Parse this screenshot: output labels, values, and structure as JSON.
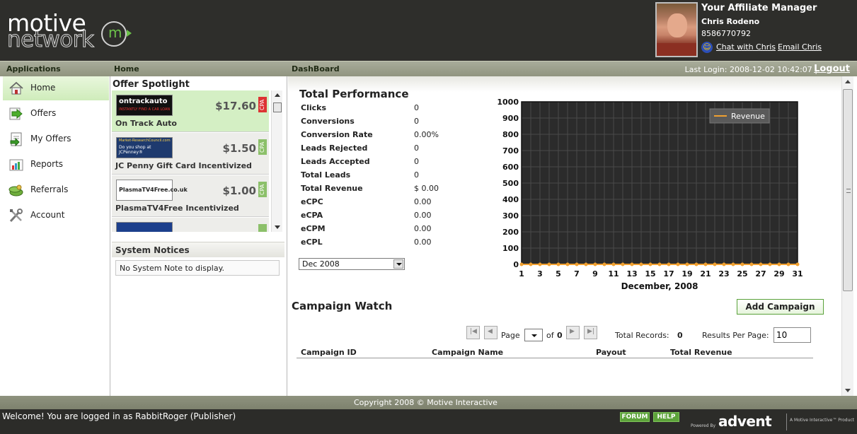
{
  "header": {
    "logo_line1": "motive",
    "logo_line2": "network",
    "logo_m": "m",
    "manager": {
      "title": "Your Affiliate Manager",
      "name": "Chris Rodeno",
      "phone": "8586770792",
      "chat_label": "Chat with Chris",
      "email_label": "Email Chris"
    }
  },
  "nav": {
    "applications": "Applications",
    "home": "Home",
    "dashboard": "DashBoard",
    "last_login": "Last Login: 2008-12-02 10:42:07 |",
    "logout": "Logout"
  },
  "sidebar": {
    "items": [
      {
        "label": "Home",
        "icon": "house-icon",
        "active": true
      },
      {
        "label": "Offers",
        "icon": "arrow-icon",
        "active": false
      },
      {
        "label": "My Offers",
        "icon": "document-icon",
        "active": false
      },
      {
        "label": "Reports",
        "icon": "report-icon",
        "active": false
      },
      {
        "label": "Referrals",
        "icon": "money-icon",
        "active": false
      },
      {
        "label": "Account",
        "icon": "tools-icon",
        "active": false
      }
    ]
  },
  "spotlight": {
    "title": "Offer Spotlight",
    "offers": [
      {
        "name": "On Track Auto",
        "price": "$17.60",
        "tag": "CPA",
        "logo_text": "ontrackauto",
        "logo_sub": "INSTANTLY FIND A CAR LOAN"
      },
      {
        "name": "JC Penny Gift Card Incentivized",
        "price": "$1.50",
        "tag": "CPA",
        "logo_text": "Do you shop at JCPenney®",
        "logo_sub": "Market-ResearchCouncil.com"
      },
      {
        "name": "PlasmaTV4Free Incentivized",
        "price": "$1.00",
        "tag": "CPA",
        "logo_text": "PlasmaTV4Free.co.uk",
        "logo_sub": ""
      }
    ]
  },
  "notices": {
    "title": "System Notices",
    "message": "No System Note to display."
  },
  "performance": {
    "title": "Total Performance",
    "stats": [
      {
        "label": "Clicks",
        "value": "0"
      },
      {
        "label": "Conversions",
        "value": "0"
      },
      {
        "label": "Conversion Rate",
        "value": "0.00%"
      },
      {
        "label": "Leads Rejected",
        "value": "0"
      },
      {
        "label": "Leads Accepted",
        "value": "0"
      },
      {
        "label": "Total Leads",
        "value": "0"
      },
      {
        "label": "Total Revenue",
        "value": "$ 0.00"
      },
      {
        "label": "eCPC",
        "value": "0.00"
      },
      {
        "label": "eCPA",
        "value": "0.00"
      },
      {
        "label": "eCPM",
        "value": "0.00"
      },
      {
        "label": "eCPL",
        "value": "0.00"
      }
    ],
    "month": "Dec 2008"
  },
  "colors": {
    "chart_bg": "#2b2b2b",
    "grid": "#4a4a4a",
    "line": "#f0a030",
    "green_accent": "#5da33b"
  },
  "chart_data": {
    "type": "line",
    "xlabel": "December, 2008",
    "ylabel": "",
    "ylim": [
      0,
      1000
    ],
    "yticks": [
      0,
      100,
      200,
      300,
      400,
      500,
      600,
      700,
      800,
      900,
      1000
    ],
    "xtick_labels": [
      "1",
      "3",
      "5",
      "7",
      "9",
      "11",
      "13",
      "15",
      "17",
      "19",
      "21",
      "23",
      "25",
      "27",
      "29",
      "31"
    ],
    "x": [
      1,
      2,
      3,
      4,
      5,
      6,
      7,
      8,
      9,
      10,
      11,
      12,
      13,
      14,
      15,
      16,
      17,
      18,
      19,
      20,
      21,
      22,
      23,
      24,
      25,
      26,
      27,
      28,
      29,
      30,
      31
    ],
    "series": [
      {
        "name": "Revenue",
        "values": [
          0,
          0,
          0,
          0,
          0,
          0,
          0,
          0,
          0,
          0,
          0,
          0,
          0,
          0,
          0,
          0,
          0,
          0,
          0,
          0,
          0,
          0,
          0,
          0,
          0,
          0,
          0,
          0,
          0,
          0,
          0
        ]
      }
    ],
    "legend": "top-right",
    "grid": true
  },
  "campaign": {
    "title": "Campaign Watch",
    "add_label": "Add Campaign",
    "page_label": "Page",
    "of_label": "of",
    "page_total": "0",
    "records_label": "Total Records:",
    "records_value": "0",
    "per_page_label": "Results Per Page:",
    "per_page_value": "10",
    "columns": [
      "Campaign ID",
      "Campaign Name",
      "Payout",
      "Total Revenue"
    ]
  },
  "footer": {
    "copyright": "Copyright 2008 © Motive Interactive",
    "welcome": "Welcome! You are logged in as RabbitRoger (Publisher)",
    "forum": "FORUM",
    "help": "HELP",
    "powered": "Powered By",
    "advent": "advent",
    "advent_sub": "A Motive Interactive™ Product"
  }
}
